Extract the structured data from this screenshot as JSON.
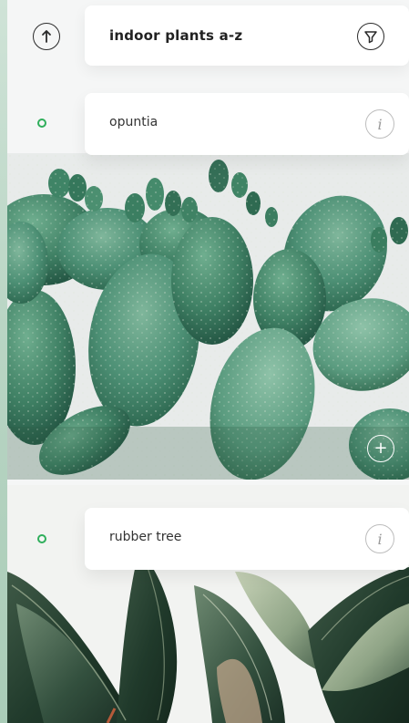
{
  "header": {
    "title": "indoor plants a-z",
    "up_icon": "arrow-up-icon",
    "filter_icon": "filter-icon"
  },
  "plants": [
    {
      "name": "opuntia",
      "info_icon": "info-icon",
      "add_icon": "plus-icon"
    },
    {
      "name": "rubber tree",
      "info_icon": "info-icon"
    }
  ],
  "colors": {
    "accent": "#2fae5b",
    "edge": "#b9d5c4"
  }
}
